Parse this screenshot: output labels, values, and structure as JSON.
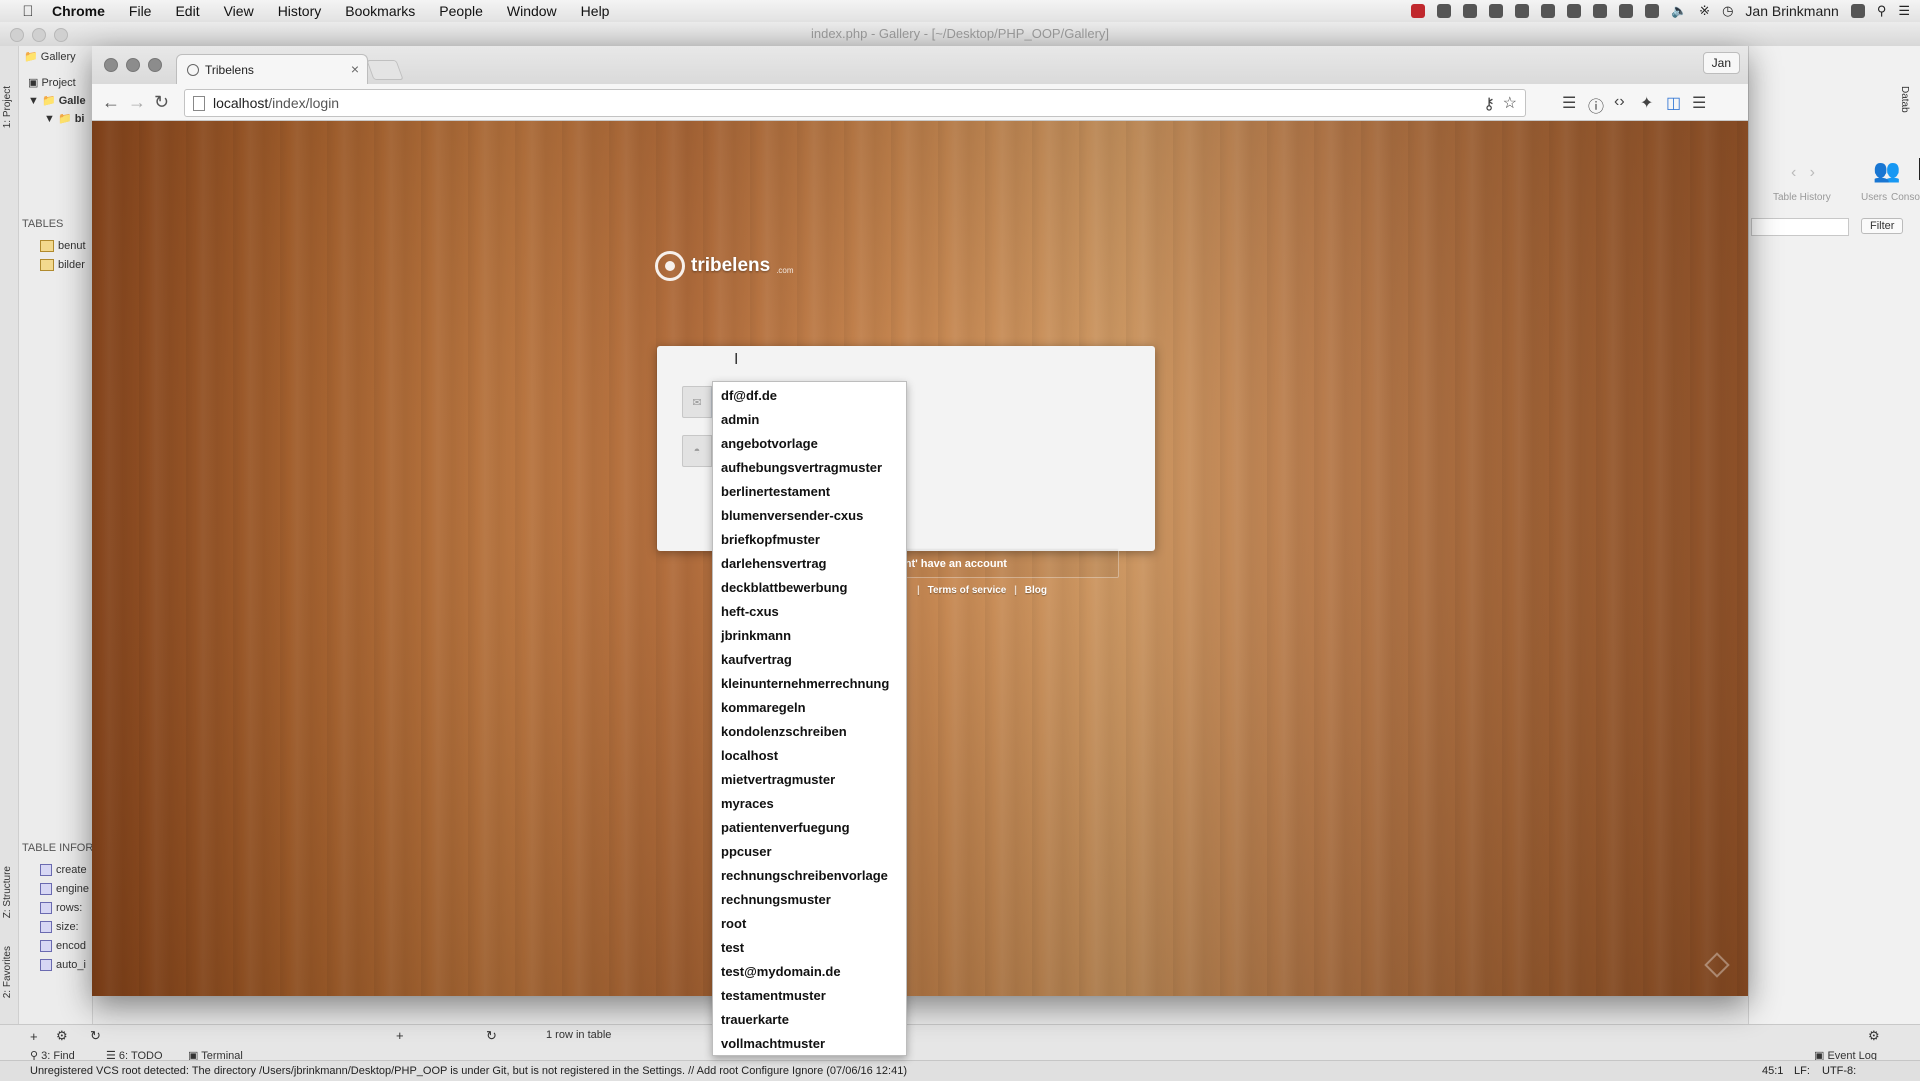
{
  "menubar": {
    "app_name": "Chrome",
    "items": [
      "File",
      "Edit",
      "View",
      "History",
      "Bookmarks",
      "People",
      "Window",
      "Help"
    ],
    "user": "Jan Brinkmann"
  },
  "ide": {
    "window_title": "index.php - Gallery - [~/Desktop/PHP_OOP/Gallery]",
    "breadcrumb": "Gallery",
    "project_tab": "Project",
    "vtab_project": "1: Project",
    "vtab_structure": "Z: Structure",
    "vtab_favorites": "2: Favorites",
    "tree_root": "Galle",
    "tree_child": "bi",
    "tables_header": "TABLES",
    "tables": [
      "benut",
      "bilder"
    ],
    "table_info_header": "TABLE INFOR",
    "table_info": [
      "create",
      "engine",
      "rows:",
      "size:",
      "encod",
      "auto_i"
    ],
    "right_panel": {
      "table_history": "Table History",
      "users": "Users",
      "console": "Conso",
      "filter_button": "Filter",
      "vtab": "Datab"
    },
    "bottom_bar": {
      "row_count": "1 row in table",
      "tabs": [
        "3: Find",
        "6: TODO",
        "Terminal"
      ],
      "event_log": "Event Log"
    },
    "status_message": "Unregistered VCS root detected: The directory /Users/jbrinkmann/Desktop/PHP_OOP is under Git, but is not registered in the Settings. // Add root  Configure  Ignore (07/06/16 12:41)",
    "status_right": {
      "position": "45:1",
      "line_sep": "LF:",
      "encoding": "UTF-8:"
    }
  },
  "browser": {
    "tab_title": "Tribelens",
    "profile": "Jan",
    "url_host": "localhost",
    "url_path": "/index/login"
  },
  "page": {
    "logo_name": "tribelens",
    "logo_tld": ".com",
    "email_value": "",
    "password_value": "",
    "signup_text": "ont' have an account",
    "footer_links": [
      "Terms of service",
      "Blog"
    ]
  },
  "autocomplete": {
    "options": [
      "df@df.de",
      "admin",
      "angebotvorlage",
      "aufhebungsvertragmuster",
      "berlinertestament",
      "blumenversender-cxus",
      "briefkopfmuster",
      "darlehensvertrag",
      "deckblattbewerbung",
      "heft-cxus",
      "jbrinkmann",
      "kaufvertrag",
      "kleinunternehmerrechnung",
      "kommaregeln",
      "kondolenzschreiben",
      "localhost",
      "mietvertragmuster",
      "myraces",
      "patientenverfuegung",
      "ppcuser",
      "rechnungschreibenvorlage",
      "rechnungsmuster",
      "root",
      "test",
      "test@mydomain.de",
      "testamentmuster",
      "trauerkarte",
      "vollmachtmuster"
    ]
  }
}
